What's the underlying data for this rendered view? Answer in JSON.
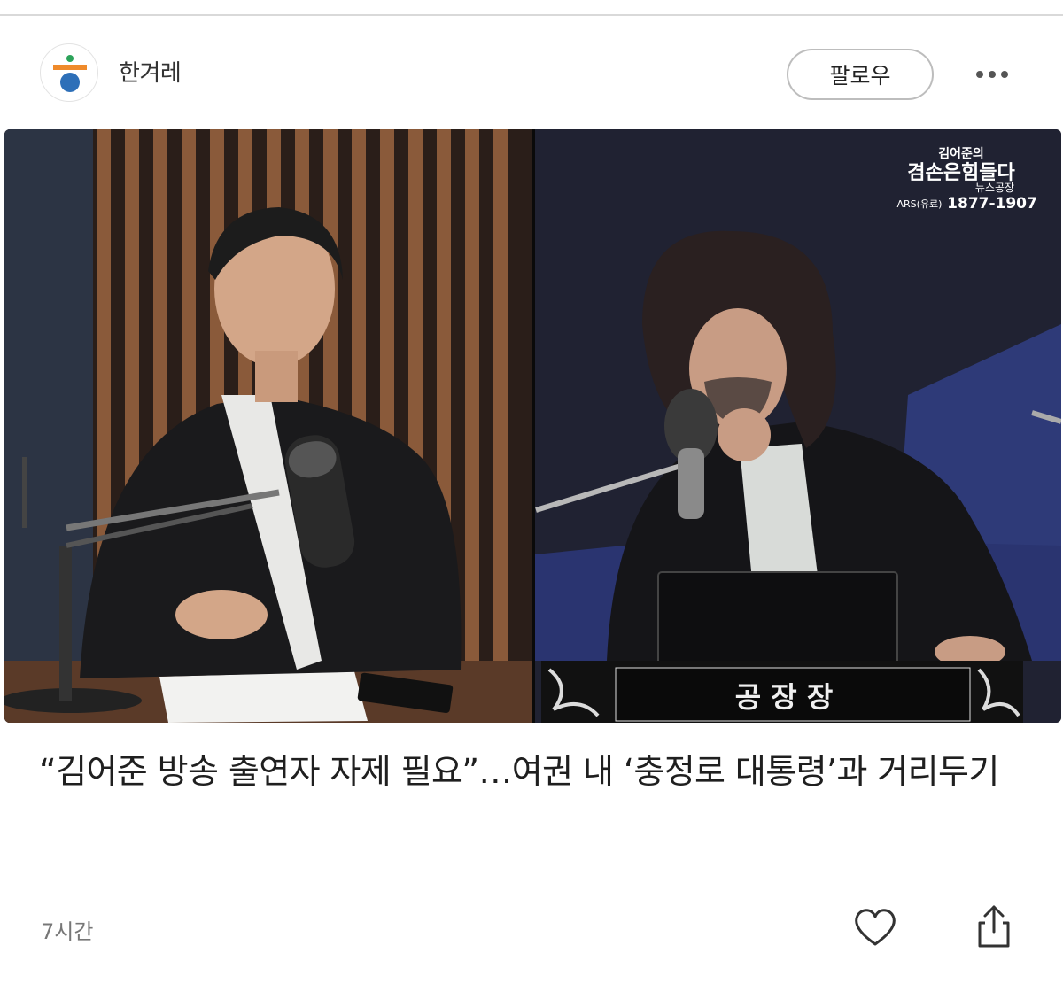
{
  "post": {
    "source_name": "한겨레",
    "follow_label": "팔로우",
    "more_icon": "more-horizontal-icon",
    "headline": "“김어준 방송 출연자 자제 필요”…여권 내 ‘충정로 대통령’과 거리두기",
    "time_ago": "7시간",
    "like_icon": "heart-outline-icon",
    "share_icon": "share-icon"
  },
  "photo": {
    "broadcast_logo_line1": "김어준의",
    "broadcast_logo_line2": "겸손은힘들다",
    "broadcast_logo_line3": "뉴스공장",
    "ars_label": "ARS(유료)",
    "ars_number": "1877-1907",
    "nameplate": "공 장 장"
  },
  "colors": {
    "logo_green": "#2ca35a",
    "logo_orange": "#ef8a2b",
    "logo_blue": "#2d6fb8"
  }
}
